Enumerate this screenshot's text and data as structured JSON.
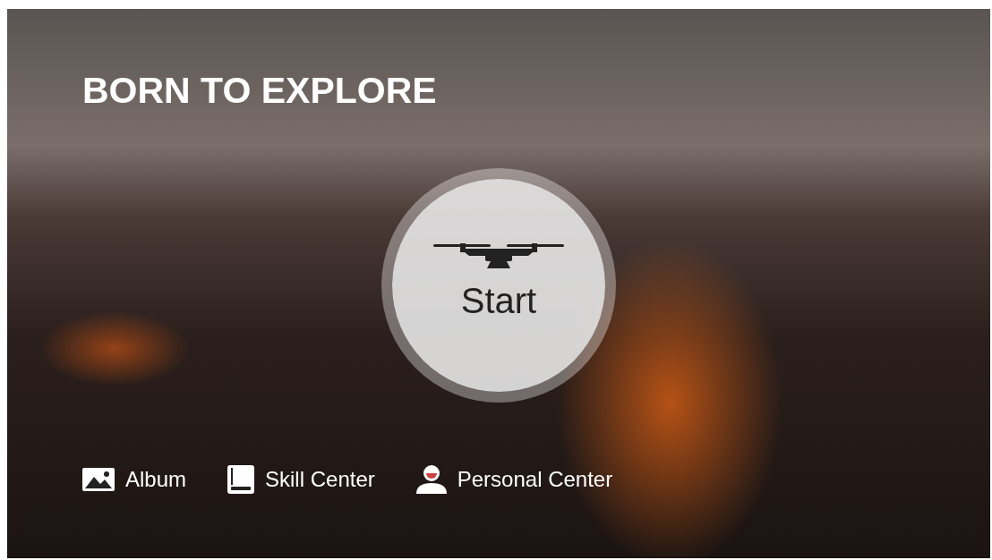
{
  "title": "BORN TO EXPLORE",
  "start_button": {
    "label": "Start"
  },
  "nav": [
    {
      "kind": "album",
      "label": "Album"
    },
    {
      "kind": "book",
      "label": "Skill Center"
    },
    {
      "kind": "person",
      "label": "Personal Center"
    }
  ]
}
